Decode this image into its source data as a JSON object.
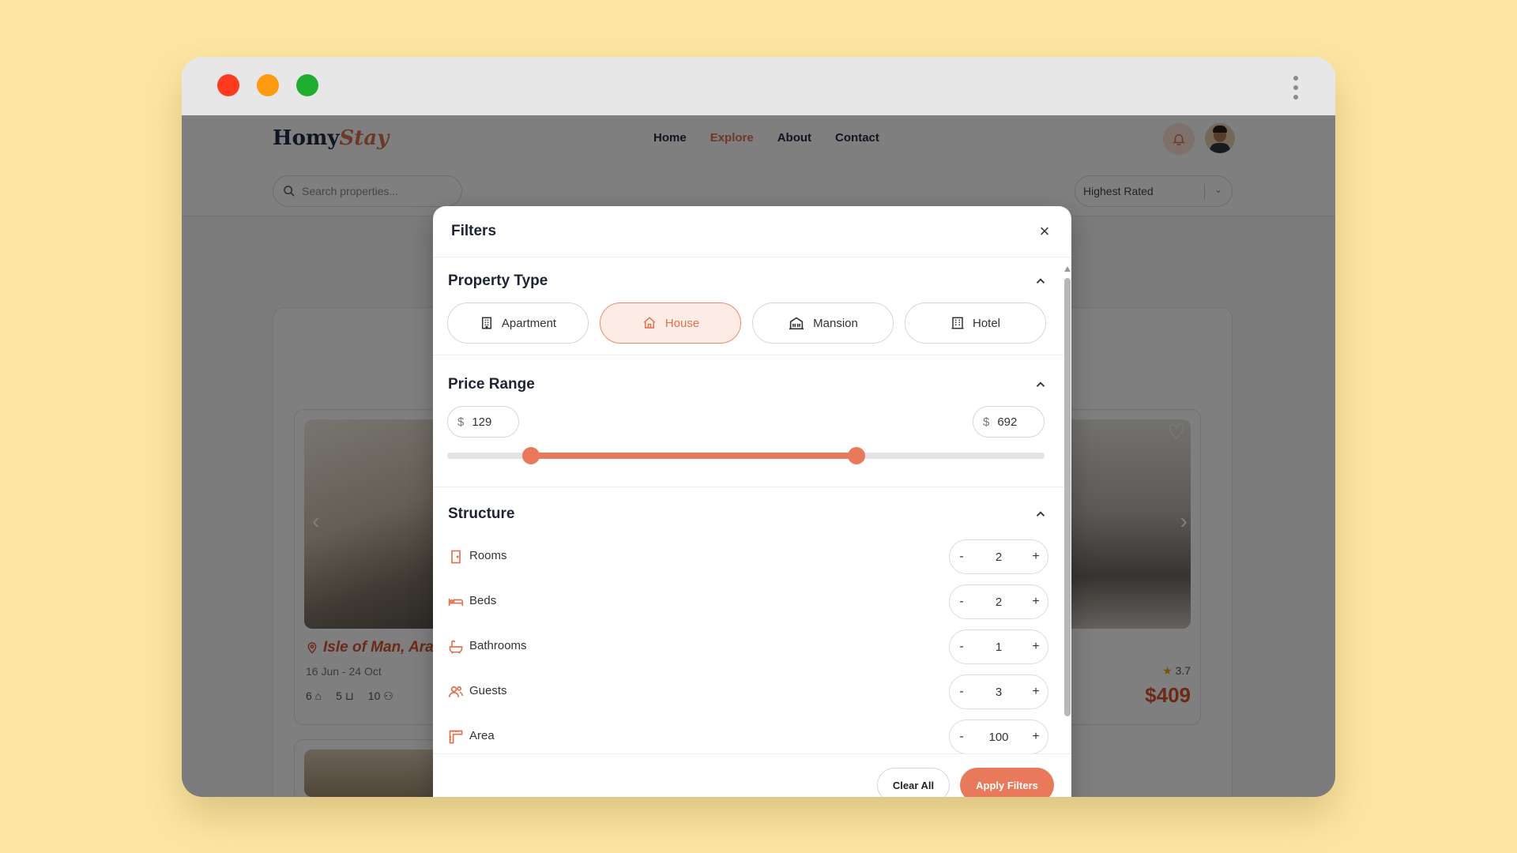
{
  "app": {
    "logo_primary": "Homy",
    "logo_secondary": "Stay",
    "nav": [
      {
        "label": "Home"
      },
      {
        "label": "Explore"
      },
      {
        "label": "About"
      },
      {
        "label": "Contact"
      }
    ],
    "nav_active": "Explore",
    "search_placeholder": "Search properties...",
    "sort_value": "Highest Rated",
    "icons": {
      "bell": "bell-icon",
      "avatar": "avatar"
    }
  },
  "cards": {
    "left": {
      "location": "Isle of Man, Ara",
      "dates": "16 Jun - 24 Oct",
      "beds": "6",
      "baths": "5",
      "guests": "10"
    },
    "right": {
      "rating": "3.7",
      "price": "$409"
    }
  },
  "modal": {
    "title": "Filters",
    "property_type": {
      "title": "Property Type",
      "options": [
        {
          "label": "Apartment",
          "icon": "apartment-icon"
        },
        {
          "label": "House",
          "icon": "house-icon"
        },
        {
          "label": "Mansion",
          "icon": "mansion-icon"
        },
        {
          "label": "Hotel",
          "icon": "hotel-icon"
        }
      ],
      "selected": "House"
    },
    "price_range": {
      "title": "Price Range",
      "currency": "$",
      "min": "129",
      "max": "692",
      "slider_min_fraction": 0.14,
      "slider_max_fraction": 0.685
    },
    "structure": {
      "title": "Structure",
      "rows": [
        {
          "label": "Rooms",
          "value": "2",
          "icon": "door-icon"
        },
        {
          "label": "Beds",
          "value": "2",
          "icon": "bed-icon"
        },
        {
          "label": "Bathrooms",
          "value": "1",
          "icon": "bathtub-icon"
        },
        {
          "label": "Guests",
          "value": "3",
          "icon": "guests-icon"
        },
        {
          "label": "Area",
          "value": "100",
          "icon": "area-icon"
        }
      ],
      "minus": "-",
      "plus": "+"
    },
    "clear_label": "Clear All",
    "apply_label": "Apply Filters"
  },
  "colors": {
    "accent": "#e8795a",
    "accent_light": "#fdebe5",
    "page_bg": "#fde6a4",
    "title_text": "#1e2433"
  }
}
